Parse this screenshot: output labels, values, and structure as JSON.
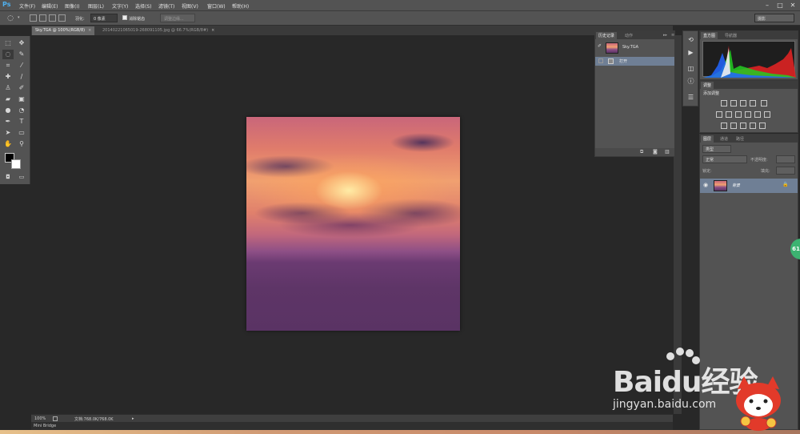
{
  "menubar": {
    "logo": "Ps",
    "items": [
      "文件(F)",
      "编辑(E)",
      "图像(I)",
      "图层(L)",
      "文字(Y)",
      "选择(S)",
      "滤镜(T)",
      "视图(V)",
      "窗口(W)",
      "帮助(H)"
    ],
    "window_controls": [
      "–",
      "□",
      "✕"
    ]
  },
  "options": {
    "feather_label": "羽化:",
    "feather_value": "0 像素",
    "antialias_label": "消除锯齿",
    "refine_edge": "调整边缘...",
    "workspace": "摄影"
  },
  "tabs": [
    {
      "label": "Sky.TGA @ 100%(RGB/8)",
      "close": "×"
    },
    {
      "label": "20140221065019-268091105.jpg @ 66.7%(RGB/8#)",
      "close": "×"
    }
  ],
  "status": {
    "zoom": "100%",
    "doc": "文档:768.0K/768.0K",
    "arrow": "▸"
  },
  "bridge": {
    "label": "Mini Bridge"
  },
  "history": {
    "tabs": [
      "历史记录",
      "动作"
    ],
    "snapshot_name": "Sky.TGA",
    "steps": [
      "打开"
    ],
    "collapse": "▸▸",
    "menu": "≡"
  },
  "histogram": {
    "tabs": [
      "直方图",
      "导航器"
    ]
  },
  "adjustments": {
    "tab": "调整",
    "title": "添加调整"
  },
  "layers": {
    "tabs": [
      "图层",
      "通道",
      "路径"
    ],
    "kind_label": "类型",
    "blend_mode": "正常",
    "opacity_label": "不透明度:",
    "lock_label": "锁定:",
    "fill_label": "填充:",
    "layer_name": "背景",
    "lock_icon": "🔒"
  },
  "badge": {
    "text": "61"
  },
  "watermark": {
    "main": "Baidu经验",
    "sub": "jingyan.baidu.com"
  },
  "colors": {
    "ui_gray": "#535353",
    "canvas_bg": "#282828",
    "accent_selected": "#6f7f95",
    "ps_blue": "#4fb0ee"
  }
}
